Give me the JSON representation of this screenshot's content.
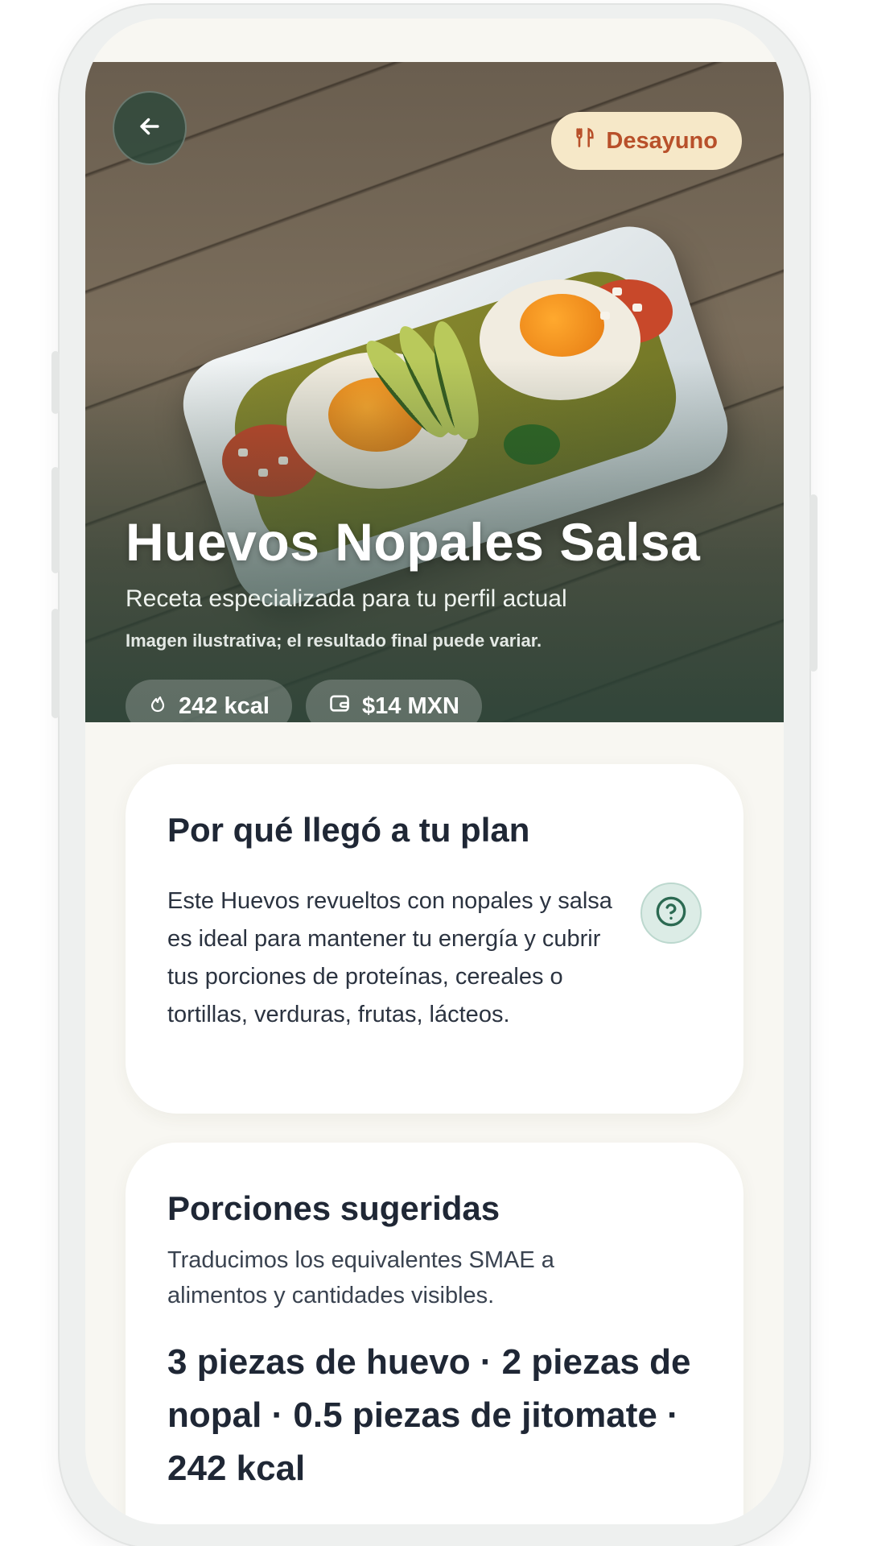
{
  "hero": {
    "back_icon": "arrow-left-icon",
    "meal_badge": {
      "icon": "utensils-icon",
      "label": "Desayuno"
    },
    "title": "Huevos Nopales Salsa",
    "subtitle": "Receta especializada para tu perfil actual",
    "note": "Imagen ilustrativa; el resultado final puede variar.",
    "chips": [
      {
        "icon": "flame-icon",
        "label": "242 kcal"
      },
      {
        "icon": "wallet-icon",
        "label": "$14 MXN"
      }
    ]
  },
  "why_card": {
    "title": "Por qué llegó a tu plan",
    "body": "Este Huevos revueltos con nopales y salsa es ideal para mantener tu energía y cubrir tus porciones de proteínas, cereales o tortillas, verduras, frutas, lácteos.",
    "help_icon": "help-circle-icon"
  },
  "portions_card": {
    "title": "Porciones sugeridas",
    "description": "Traducimos los equivalentes SMAE a alimentos y cantidades visibles.",
    "summary": "3 piezas de huevo · 2 piezas de nopal · 0.5 piezas de jitomate · 242 kcal"
  },
  "colors": {
    "brand_green": "#2c483a",
    "badge_bg": "#f6e8c8",
    "badge_text": "#b8502a",
    "page_bg": "#f8f7f2",
    "title_text": "#1f2735"
  }
}
